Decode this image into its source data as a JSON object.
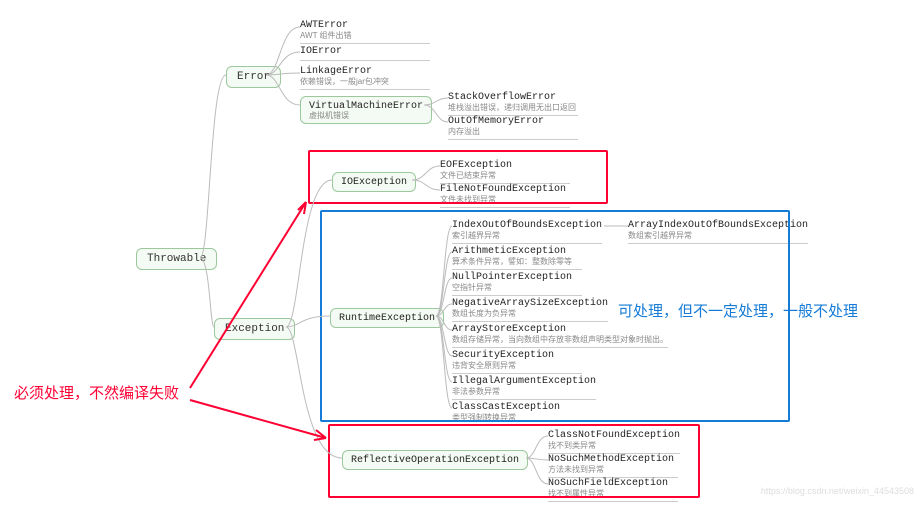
{
  "root": "Throwable",
  "error": {
    "label": "Error",
    "children": [
      {
        "t": "AWTError",
        "s": "AWT 组件出错"
      },
      {
        "t": "IOError",
        "s": ""
      },
      {
        "t": "LinkageError",
        "s": "依赖错误，一般jar包冲突"
      },
      {
        "t": "VirtualMachineError",
        "s": "虚拟机错误",
        "ch": [
          {
            "t": "StackOverflowError",
            "s": "堆栈溢出错误，递归调用无出口返回"
          },
          {
            "t": "OutOfMemoryError",
            "s": "内存溢出"
          }
        ]
      }
    ]
  },
  "exception": {
    "label": "Exception",
    "io": {
      "label": "IOException",
      "ch": [
        {
          "t": "EOFException",
          "s": "文件已结束异常"
        },
        {
          "t": "FileNotFoundException",
          "s": "文件未找到异常"
        }
      ]
    },
    "runtime": {
      "label": "RuntimeException",
      "ch": [
        {
          "t": "IndexOutOfBoundsException",
          "s": "索引越界异常",
          "ch": [
            {
              "t": "ArrayIndexOutOfBoundsException",
              "s": "数组索引越界异常"
            }
          ]
        },
        {
          "t": "ArithmeticException",
          "s": "算术条件异常，譬如：整数除零等"
        },
        {
          "t": "NullPointerException",
          "s": "空指针异常"
        },
        {
          "t": "NegativeArraySizeException",
          "s": "数组长度为负异常"
        },
        {
          "t": "ArrayStoreException",
          "s": "数组存储异常，当向数组中存放非数组声明类型对象时抛出。"
        },
        {
          "t": "SecurityException",
          "s": "违背安全原则异常"
        },
        {
          "t": "IllegalArgumentException",
          "s": "非法参数异常"
        },
        {
          "t": "ClassCastException",
          "s": "类型强制转换异常"
        }
      ]
    },
    "reflect": {
      "label": "ReflectiveOperationException",
      "ch": [
        {
          "t": "ClassNotFoundException",
          "s": "找不到类异常"
        },
        {
          "t": "NoSuchMethodException",
          "s": "方法未找到异常"
        },
        {
          "t": "NoSuchFieldException",
          "s": "找不到属性异常"
        }
      ]
    }
  },
  "ann_red": "必须处理，不然编译失败",
  "ann_blue": "可处理，但不一定处理，一般不处理",
  "watermark": "https://blog.csdn.net/weixin_44543508"
}
